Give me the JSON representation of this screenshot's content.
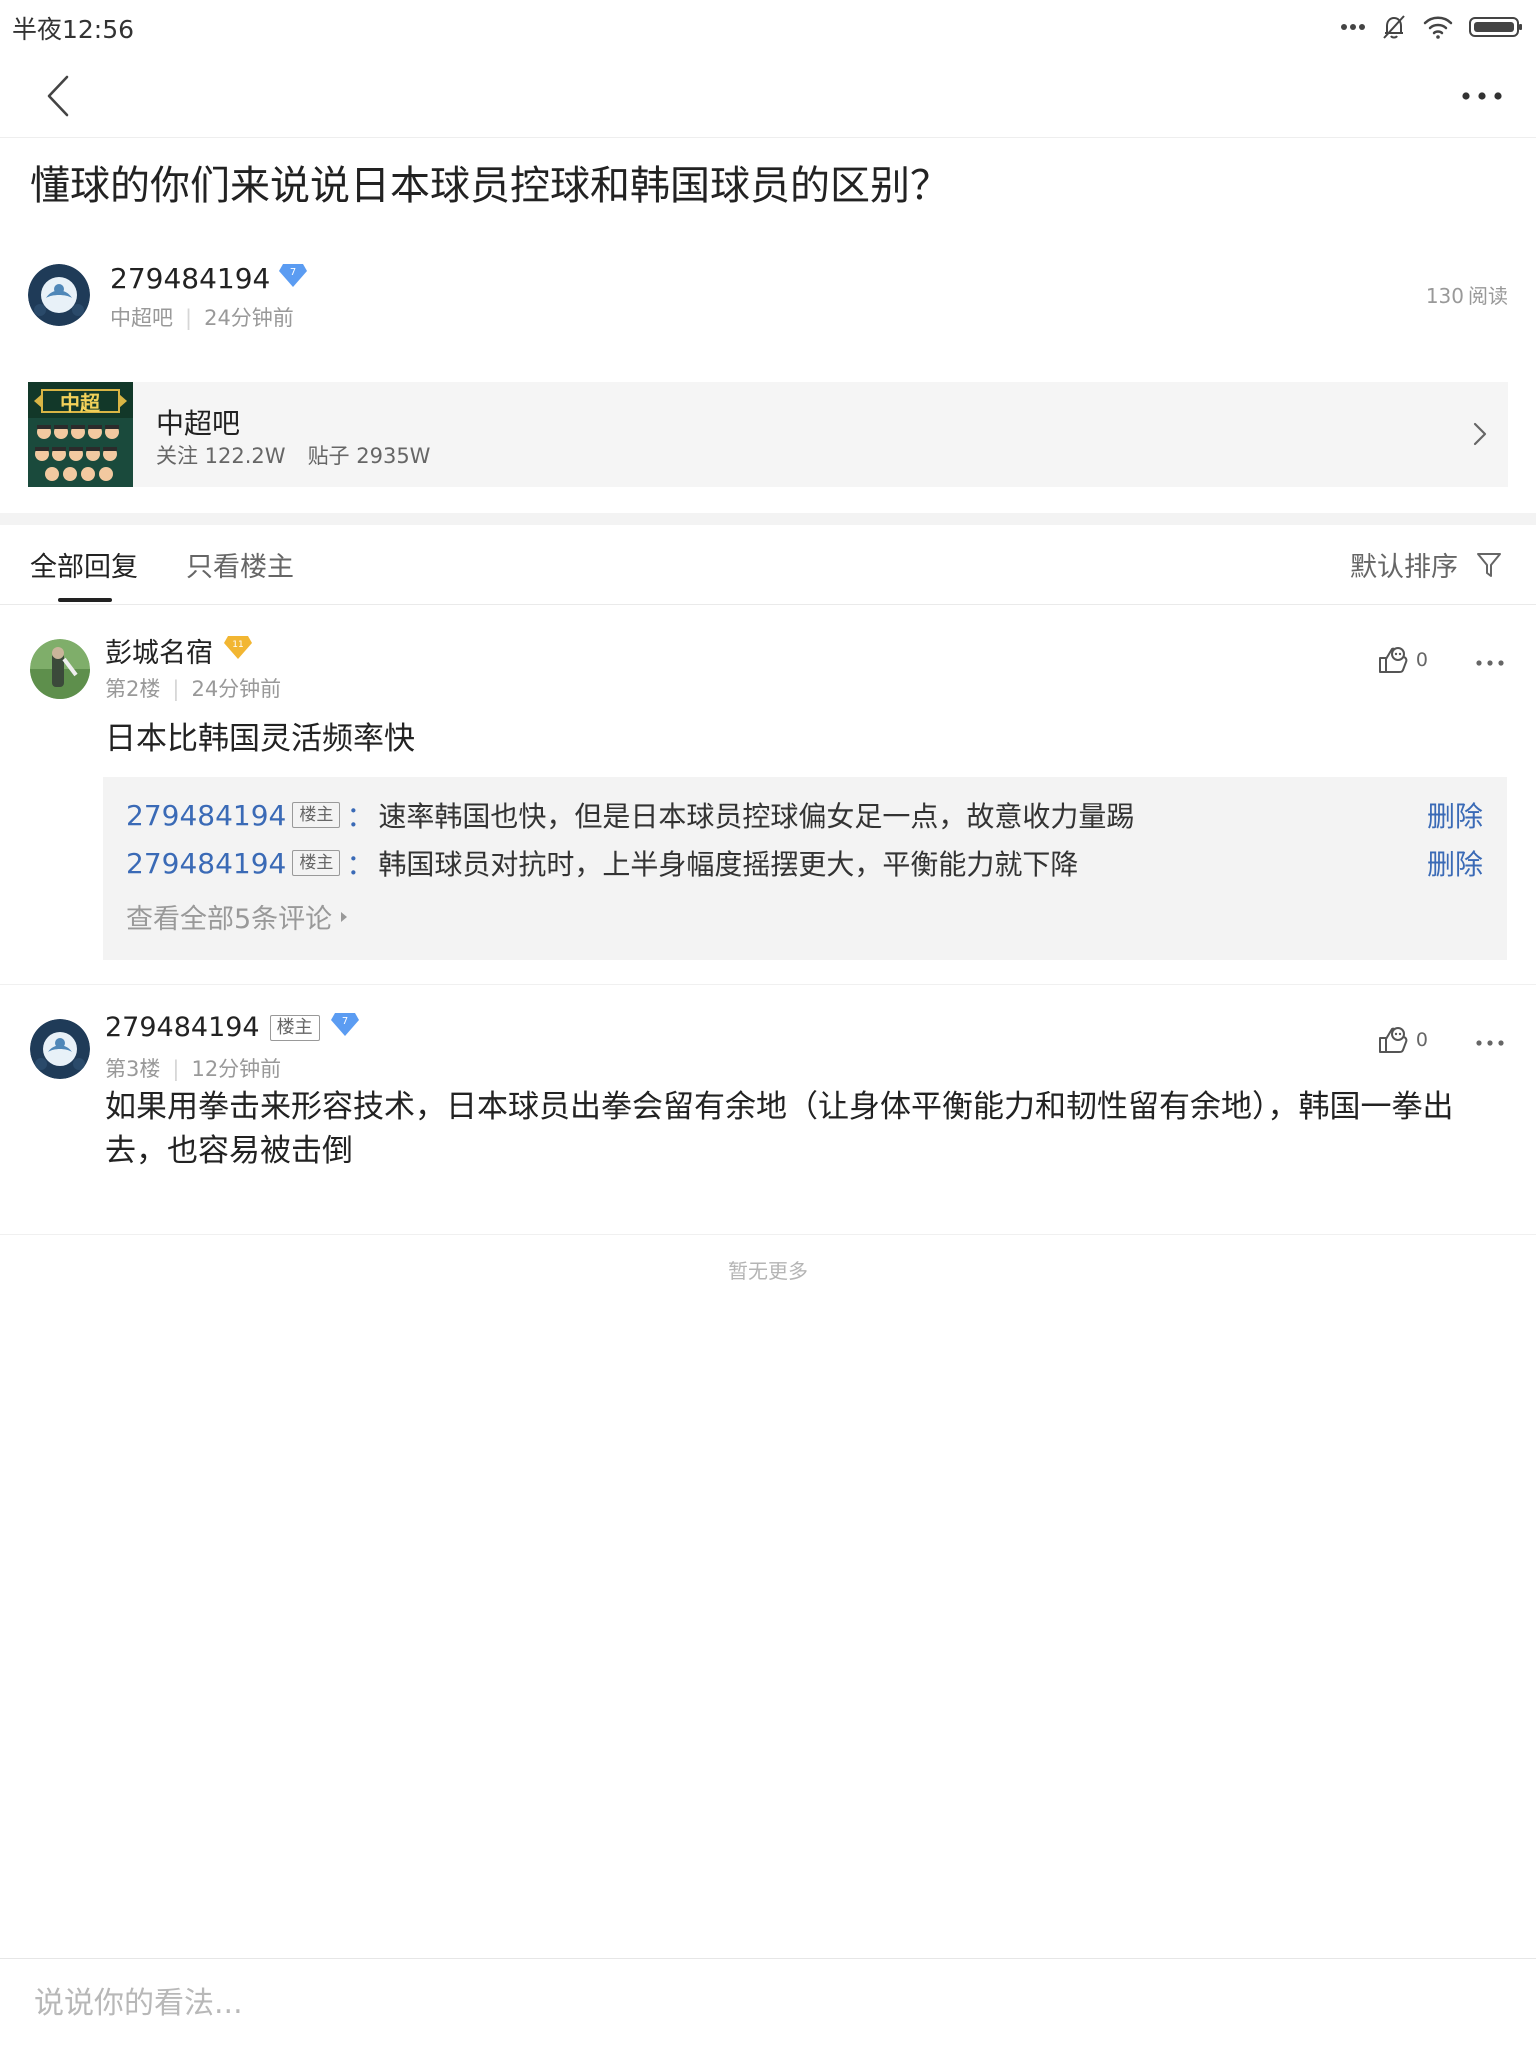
{
  "status_bar": {
    "time": "半夜12:56"
  },
  "post": {
    "title": "懂球的你们来说说日本球员控球和韩国球员的区别？",
    "author": {
      "name": "279484194",
      "level": "7",
      "forum": "中超吧",
      "time": "24分钟前"
    },
    "read_count": "130",
    "read_label": "阅读"
  },
  "forum_card": {
    "name": "中超吧",
    "followers": "关注 122.2W",
    "posts": "贴子 2935W",
    "logo_text": "中超"
  },
  "tabs": {
    "all": "全部回复",
    "op_only": "只看楼主",
    "sort": "默认排序"
  },
  "replies": [
    {
      "name": "彭城名宿",
      "level": "11",
      "floor": "第2楼",
      "time": "24分钟前",
      "likes": "0",
      "content": "日本比韩国灵活频率快",
      "comments": [
        {
          "user": "279484194",
          "tag": "楼主",
          "colon": "：",
          "text": "速率韩国也快，但是日本球员控球偏女足一点，故意收力量踢",
          "action": "删除"
        },
        {
          "user": "279484194",
          "tag": "楼主",
          "colon": "：",
          "text": "韩国球员对抗时，上半身幅度摇摆更大，平衡能力就下降",
          "action": "删除"
        }
      ],
      "view_all": "查看全部5条评论"
    },
    {
      "name": "279484194",
      "tag": "楼主",
      "level": "7",
      "floor": "第3楼",
      "time": "12分钟前",
      "likes": "0",
      "content": "如果用拳击来形容技术，日本球员出拳会留有余地（让身体平衡能力和韧性留有余地），韩国一拳出去，也容易被击倒"
    }
  ],
  "footer": {
    "no_more": "暂无更多"
  },
  "input": {
    "placeholder": "说说你的看法..."
  },
  "colors": {
    "link": "#3a6ab6",
    "level_blue": "#5b9cf2",
    "level_gold": "#f2b632",
    "card_bg": "#f5f5f5"
  }
}
